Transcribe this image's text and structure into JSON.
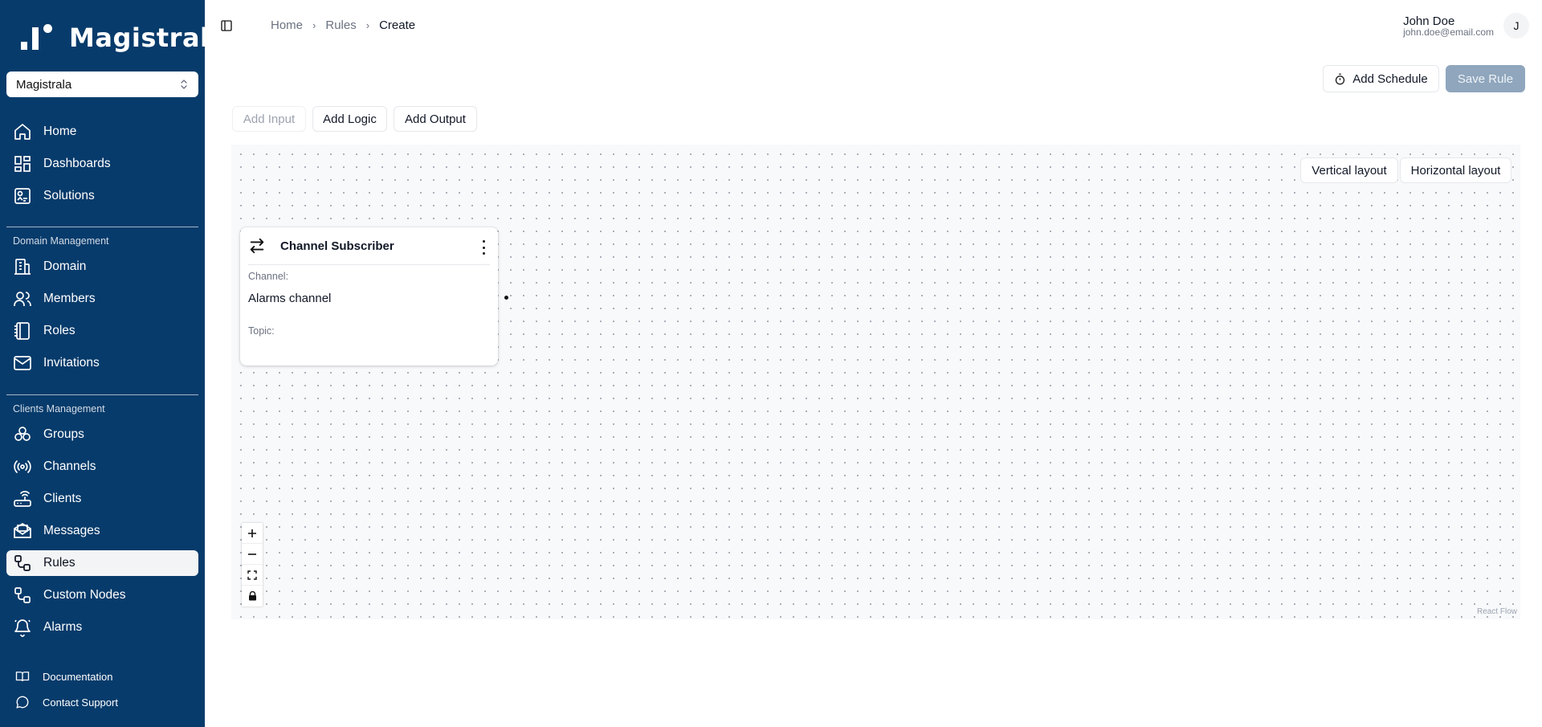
{
  "app": {
    "logo_text": "Magistrala"
  },
  "domain_selector": {
    "value": "Magistrala"
  },
  "sidebar": {
    "primary": [
      {
        "label": "Home",
        "icon": "home-icon"
      },
      {
        "label": "Dashboards",
        "icon": "dashboard-icon"
      },
      {
        "label": "Solutions",
        "icon": "solutions-icon"
      }
    ],
    "domain_section_label": "Domain Management",
    "domain_items": [
      {
        "label": "Domain",
        "icon": "building-icon"
      },
      {
        "label": "Members",
        "icon": "users-icon"
      },
      {
        "label": "Roles",
        "icon": "notebook-icon"
      },
      {
        "label": "Invitations",
        "icon": "mail-icon"
      }
    ],
    "clients_section_label": "Clients Management",
    "clients_items": [
      {
        "label": "Groups",
        "icon": "groups-icon"
      },
      {
        "label": "Channels",
        "icon": "radio-icon"
      },
      {
        "label": "Clients",
        "icon": "router-icon"
      },
      {
        "label": "Messages",
        "icon": "mail-open-icon"
      },
      {
        "label": "Rules",
        "icon": "workflow-icon",
        "active": true
      },
      {
        "label": "Custom Nodes",
        "icon": "workflow-icon"
      },
      {
        "label": "Alarms",
        "icon": "bell-icon"
      }
    ],
    "footer": [
      {
        "label": "Documentation",
        "icon": "book-icon"
      },
      {
        "label": "Contact Support",
        "icon": "chat-icon"
      }
    ]
  },
  "breadcrumb": {
    "home": "Home",
    "rules": "Rules",
    "current": "Create"
  },
  "user": {
    "name": "John Doe",
    "email": "john.doe@email.com",
    "initial": "J"
  },
  "actions": {
    "add_schedule": "Add Schedule",
    "save_rule": "Save Rule"
  },
  "toolbar": {
    "add_input": "Add Input",
    "add_logic": "Add Logic",
    "add_output": "Add Output"
  },
  "layout_buttons": {
    "vertical": "Vertical layout",
    "horizontal": "Horizontal layout"
  },
  "node": {
    "title": "Channel Subscriber",
    "channel_label": "Channel:",
    "channel_value": "Alarms channel",
    "topic_label": "Topic:",
    "topic_value": ""
  },
  "flow": {
    "attribution": "React Flow"
  },
  "colors": {
    "sidebar_bg": "#073b6b",
    "save_disabled": "#8fa6bd",
    "canvas_bg": "#f8f9fb"
  }
}
